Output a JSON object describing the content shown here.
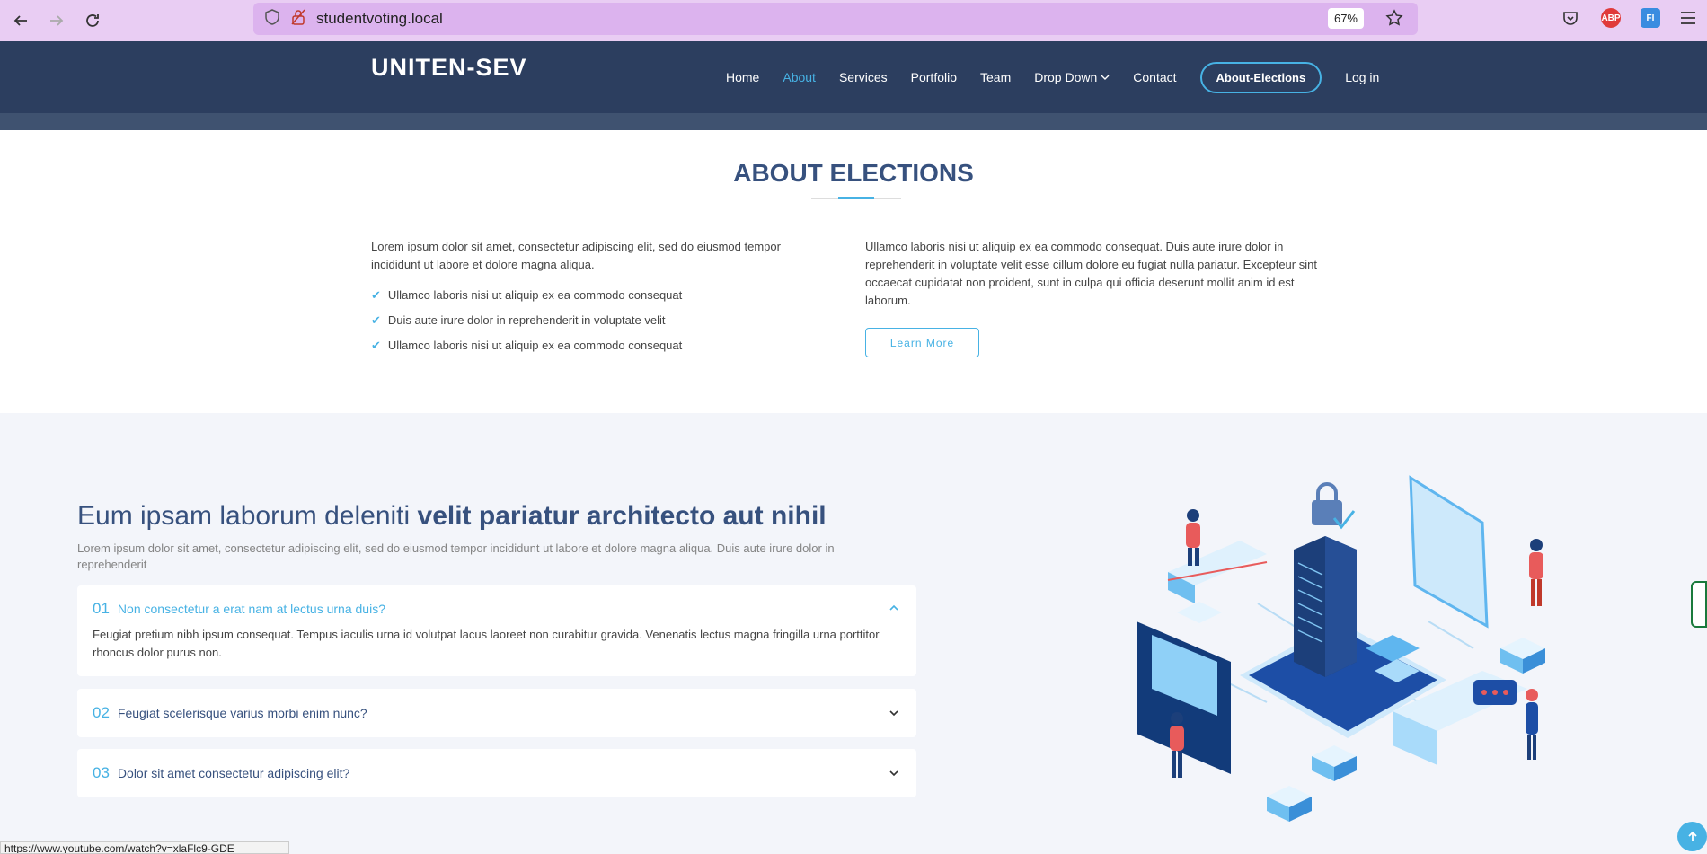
{
  "browser": {
    "url": "studentvoting.local",
    "zoom": "67%",
    "status_url": "https://www.youtube.com/watch?v=xlaFlc9-GDE",
    "ext_abp": "ABP",
    "ext_fi": "FI"
  },
  "header": {
    "logo": "UNITEN-SEV",
    "menu": [
      {
        "label": "Home"
      },
      {
        "label": "About"
      },
      {
        "label": "Services"
      },
      {
        "label": "Portfolio"
      },
      {
        "label": "Team"
      },
      {
        "label": "Drop Down"
      },
      {
        "label": "Contact"
      },
      {
        "label": "About-Elections"
      },
      {
        "label": "Log in"
      }
    ]
  },
  "about": {
    "title": "ABOUT ELECTIONS",
    "left_text": "Lorem ipsum dolor sit amet, consectetur adipiscing elit, sed do eiusmod tempor incididunt ut labore et dolore magna aliqua.",
    "bullets": [
      "Ullamco laboris nisi ut aliquip ex ea commodo consequat",
      "Duis aute irure dolor in reprehenderit in voluptate velit",
      "Ullamco laboris nisi ut aliquip ex ea commodo consequat"
    ],
    "right_text": "Ullamco laboris nisi ut aliquip ex ea commodo consequat. Duis aute irure dolor in reprehenderit in voluptate velit esse cillum dolore eu fugiat nulla pariatur. Excepteur sint occaecat cupidatat non proident, sunt in culpa qui officia deserunt mollit anim id est laborum.",
    "button": "Learn More"
  },
  "why": {
    "title_light": "Eum ipsam laborum deleniti ",
    "title_bold": "velit pariatur architecto aut nihil",
    "intro": "Lorem ipsum dolor sit amet, consectetur adipiscing elit, sed do eiusmod tempor incididunt ut labore et dolore magna aliqua. Duis aute irure dolor in reprehenderit",
    "faqs": [
      {
        "num": "01",
        "question": "Non consectetur a erat nam at lectus urna duis?",
        "answer": "Feugiat pretium nibh ipsum consequat. Tempus iaculis urna id volutpat lacus laoreet non curabitur gravida. Venenatis lectus magna fringilla urna porttitor rhoncus dolor purus non.",
        "open": true
      },
      {
        "num": "02",
        "question": "Feugiat scelerisque varius morbi enim nunc?",
        "open": false
      },
      {
        "num": "03",
        "question": "Dolor sit amet consectetur adipiscing elit?",
        "open": false
      }
    ]
  },
  "icons": [
    "back-icon",
    "forward-icon",
    "reload-icon",
    "shield-icon",
    "lock-icon",
    "star-icon",
    "pocket-icon",
    "chevron-down-icon",
    "chevron-up-icon",
    "check-icon",
    "arrow-up-icon"
  ],
  "colors": {
    "header_bg": "#2c3e5f",
    "accent": "#47b2e4",
    "heading": "#37517e",
    "section_bg": "#f3f5fa"
  }
}
